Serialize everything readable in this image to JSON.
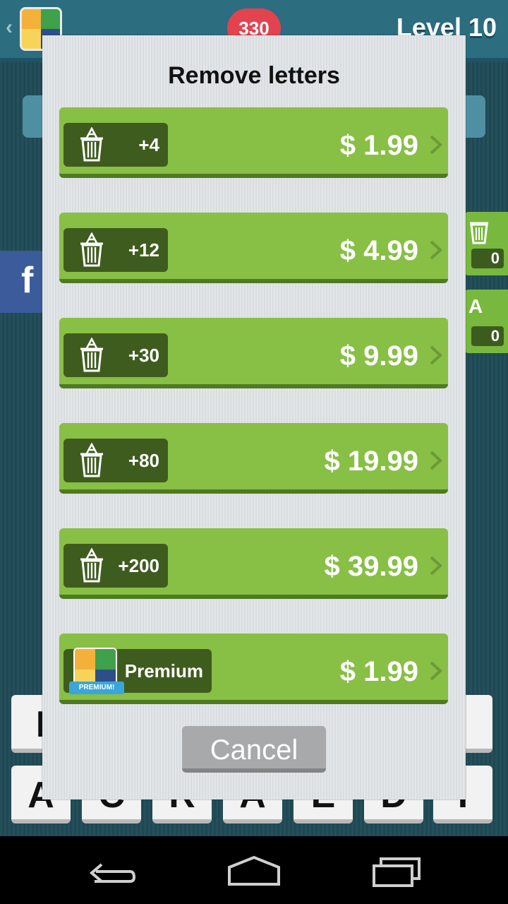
{
  "game": {
    "coins": "330",
    "level": "Level 10",
    "side_counts": [
      "0",
      "0"
    ],
    "side_reveal_glyph": "A",
    "facebook_glyph": "f",
    "tiles_row1": [
      "I",
      "",
      "",
      "",
      "",
      "",
      "."
    ],
    "tiles_row2": [
      "A",
      "C",
      "R",
      "A",
      "E",
      "D",
      "I"
    ]
  },
  "modal": {
    "title": "Remove letters",
    "offers": [
      {
        "amount": "+4",
        "price": "$ 1.99"
      },
      {
        "amount": "+12",
        "price": "$ 4.99"
      },
      {
        "amount": "+30",
        "price": "$ 9.99"
      },
      {
        "amount": "+80",
        "price": "$ 19.99"
      },
      {
        "amount": "+200",
        "price": "$ 39.99"
      }
    ],
    "premium": {
      "label": "Premium",
      "ribbon": "PREMIUM!",
      "price": "$ 1.99"
    },
    "cancel_label": "Cancel"
  },
  "colors": {
    "offer_green": "#88bf45",
    "pill_dark_green": "#3f5c1f",
    "cancel_gray": "#a7a9ab",
    "coin_red": "#e1434f"
  }
}
